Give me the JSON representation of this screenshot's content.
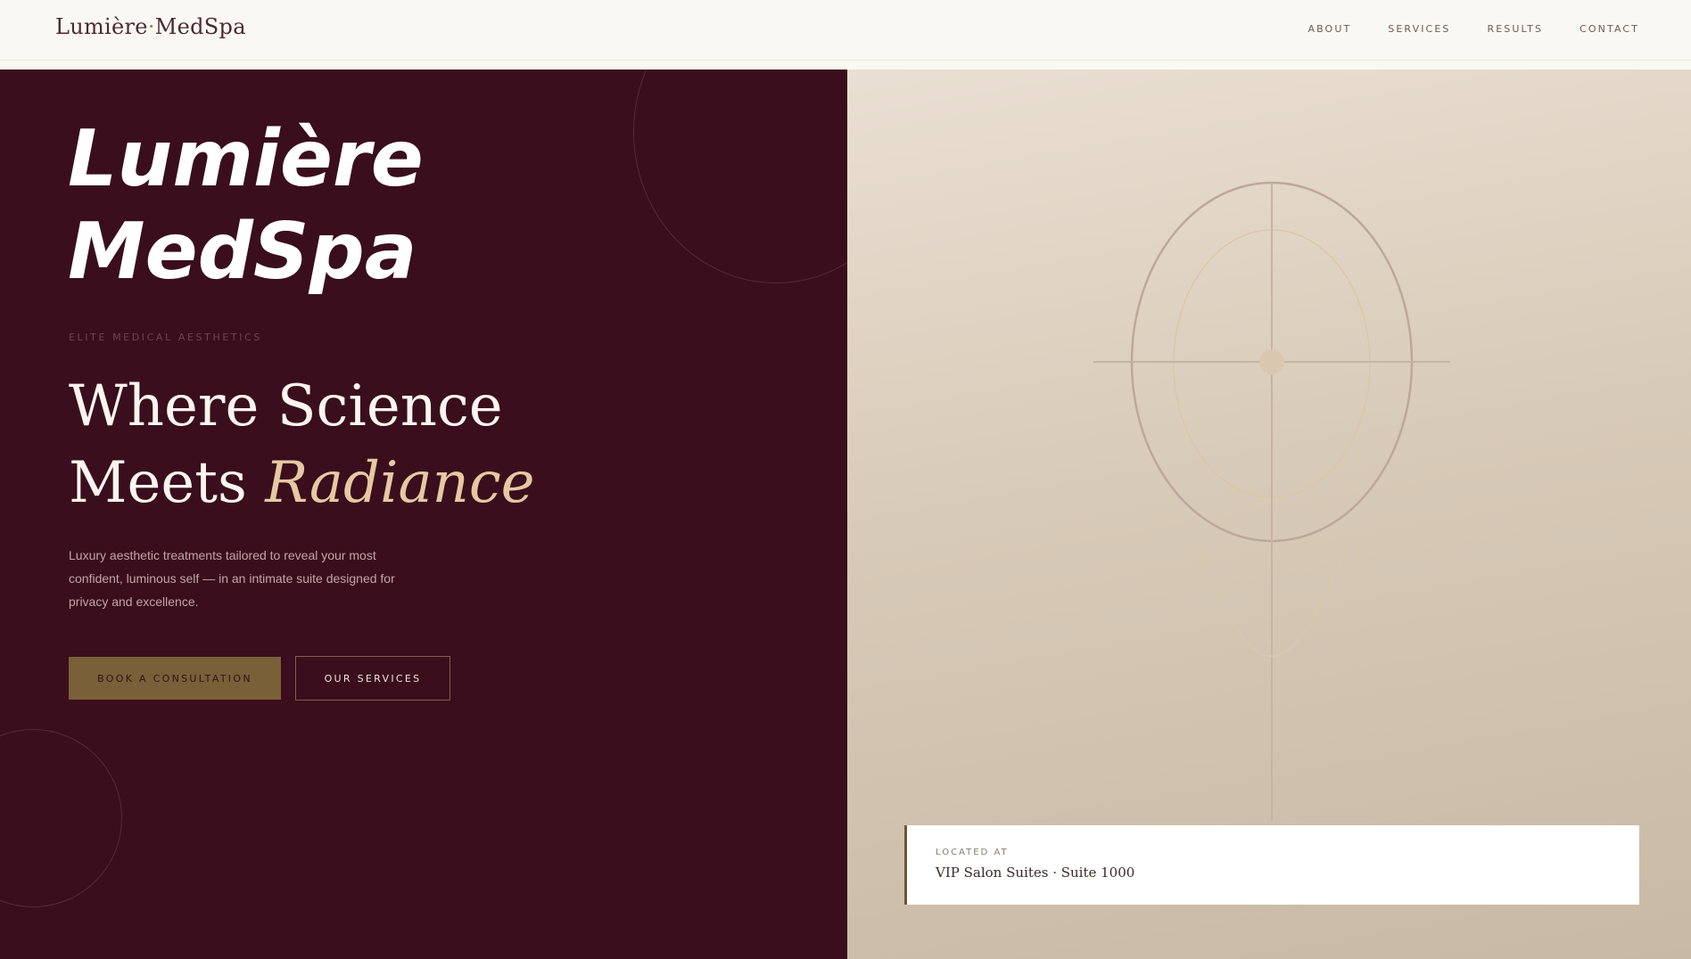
{
  "header": {
    "brand_first": "Lumière",
    "brand_sep": "·",
    "brand_second": "MedSpa",
    "nav": [
      "ABOUT",
      "SERVICES",
      "RESULTS",
      "CONTACT"
    ]
  },
  "hero": {
    "title_line1": "Lumière",
    "title_line2": "MedSpa",
    "eyebrow": "ELITE MEDICAL AESTHETICS",
    "headline_line1": "Where Science",
    "headline_line2_plain": "Meets ",
    "headline_line2_accent": "Radiance",
    "lede": "Luxury aesthetic treatments tailored to reveal your most confident, luminous self — in an intimate suite designed for privacy and excellence.",
    "primary_cta": "BOOK A CONSULTATION",
    "secondary_cta": "OUR SERVICES"
  },
  "location": {
    "label": "LOCATED AT",
    "value": "VIP Salon Suites · Suite 1000"
  },
  "colors": {
    "burgundy": "#3a0e1d",
    "gold": "#7a6038",
    "cream": "#faf8f2",
    "accent_text": "#e6c8a2"
  },
  "icons": [
    "decorative-ring",
    "face-line-illustration"
  ]
}
